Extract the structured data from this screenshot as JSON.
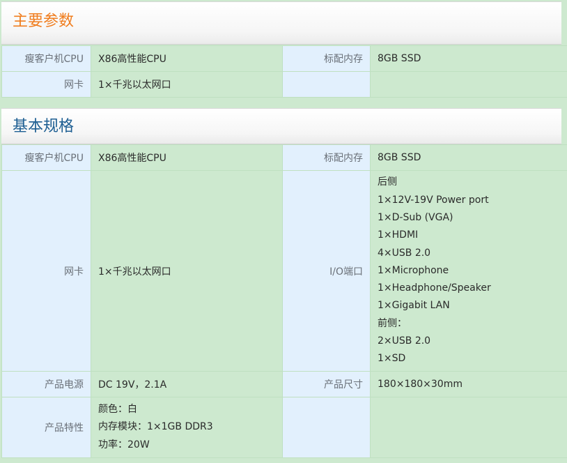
{
  "main_params": {
    "title": "主要参数",
    "rows": [
      {
        "label1": "瘦客户机CPU",
        "value1": "X86高性能CPU",
        "label2": "标配内存",
        "value2": "8GB SSD"
      },
      {
        "label1": "网卡",
        "value1": "1×千兆以太网口",
        "label2": "",
        "value2": ""
      }
    ]
  },
  "basic_specs": {
    "title": "基本规格",
    "cpu_label": "瘦客户机CPU",
    "cpu_value": "X86高性能CPU",
    "memory_label": "标配内存",
    "memory_value": "8GB SSD",
    "nic_label": "网卡",
    "nic_value": "1×千兆以太网口",
    "io_label": "I/O端口",
    "io_lines": [
      "后侧",
      "1×12V-19V Power port",
      "1×D-Sub (VGA)",
      "1×HDMI",
      "4×USB 2.0",
      "1×Microphone",
      "1×Headphone/Speaker",
      "1×Gigabit LAN",
      "前侧：",
      "2×USB 2.0",
      "1×SD"
    ],
    "power_label": "产品电源",
    "power_value": "DC 19V，2.1A",
    "size_label": "产品尺寸",
    "size_value": "180×180×30mm",
    "features_label": "产品特性",
    "features_lines": [
      "颜色：白",
      "内存模块：1×1GB DDR3",
      "功率：20W"
    ]
  }
}
